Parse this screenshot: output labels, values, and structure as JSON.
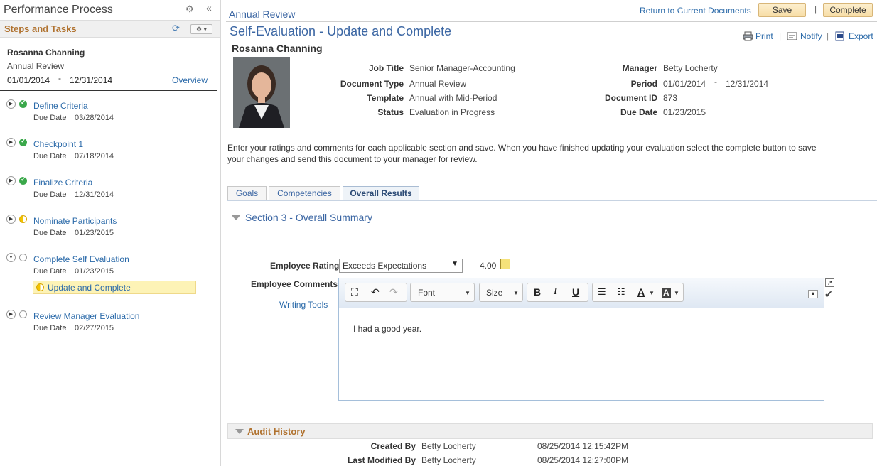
{
  "left_panel": {
    "title": "Performance Process",
    "steps_header": "Steps and Tasks",
    "steps_menu": "⚙ ▾",
    "employee": {
      "name": "Rosanna Channing",
      "document": "Annual Review",
      "start": "01/01/2014",
      "dash": "-",
      "end": "12/31/2014",
      "overview": "Overview"
    },
    "steps": [
      {
        "label": "Define Criteria",
        "due_label": "Due Date",
        "due": "03/28/2014",
        "status": "complete"
      },
      {
        "label": "Checkpoint 1",
        "due_label": "Due Date",
        "due": "07/18/2014",
        "status": "complete"
      },
      {
        "label": "Finalize Criteria",
        "due_label": "Due Date",
        "due": "12/31/2014",
        "status": "complete"
      },
      {
        "label": "Nominate Participants",
        "due_label": "Due Date",
        "due": "01/23/2015",
        "status": "in-progress"
      },
      {
        "label": "Complete Self Evaluation",
        "due_label": "Due Date",
        "due": "01/23/2015",
        "status": "not-started",
        "expanded": true
      },
      {
        "label": "Review Manager Evaluation",
        "due_label": "Due Date",
        "due": "02/27/2015",
        "status": "not-started"
      }
    ],
    "subtask": {
      "label": "Update and Complete",
      "status": "in-progress"
    }
  },
  "header": {
    "document_type": "Annual Review",
    "return_link": "Return to Current Documents",
    "save": "Save",
    "separator": "|",
    "complete": "Complete"
  },
  "page": {
    "title": "Self-Evaluation - Update and Complete",
    "actions": {
      "print": "Print",
      "notify": "Notify",
      "export": "Export",
      "sep": "|"
    },
    "employee_name": "Rosanna Channing"
  },
  "fields": {
    "job_title": {
      "label": "Job Title",
      "value": "Senior Manager-Accounting"
    },
    "document_type": {
      "label": "Document Type",
      "value": "Annual Review"
    },
    "template": {
      "label": "Template",
      "value": "Annual with Mid-Period"
    },
    "status": {
      "label": "Status",
      "value": "Evaluation in Progress"
    },
    "manager": {
      "label": "Manager",
      "value": "Betty Locherty"
    },
    "period": {
      "label": "Period",
      "start": "01/01/2014",
      "dash": "-",
      "end": "12/31/2014"
    },
    "document_id": {
      "label": "Document ID",
      "value": "873"
    },
    "due_date": {
      "label": "Due Date",
      "value": "01/23/2015"
    }
  },
  "instructions": "Enter your ratings and comments for each applicable section and save. When you have finished updating your evaluation select the complete button to save your changes and send this document to your manager for review.",
  "tabs": [
    {
      "label": "Goals"
    },
    {
      "label": "Competencies"
    },
    {
      "label": "Overall Results",
      "active": true
    }
  ],
  "section": {
    "title": "Section 3 - Overall Summary",
    "rating_label": "Employee Rating",
    "rating_value": "Exceeds Expectations",
    "rating_score": "4.00",
    "comments_label": "Employee Comments",
    "writing_tools": "Writing Tools",
    "editor": {
      "font": "Font",
      "size": "Size",
      "content": "I had a good year."
    }
  },
  "audit": {
    "title": "Audit History",
    "created_by_label": "Created By",
    "created_by": "Betty Locherty",
    "created_at": "08/25/2014 12:15:42PM",
    "modified_by_label": "Last Modified By",
    "modified_by": "Betty Locherty",
    "modified_at": "08/25/2014 12:27:00PM"
  },
  "colors": {
    "link": "#2b6aa9",
    "title": "#3b66a3",
    "section_header": "#b0722f",
    "button_bg": "#f7dea7",
    "complete_status": "#3aa84a",
    "progress_status": "#f3c300",
    "highlight": "#fdf3b6"
  }
}
